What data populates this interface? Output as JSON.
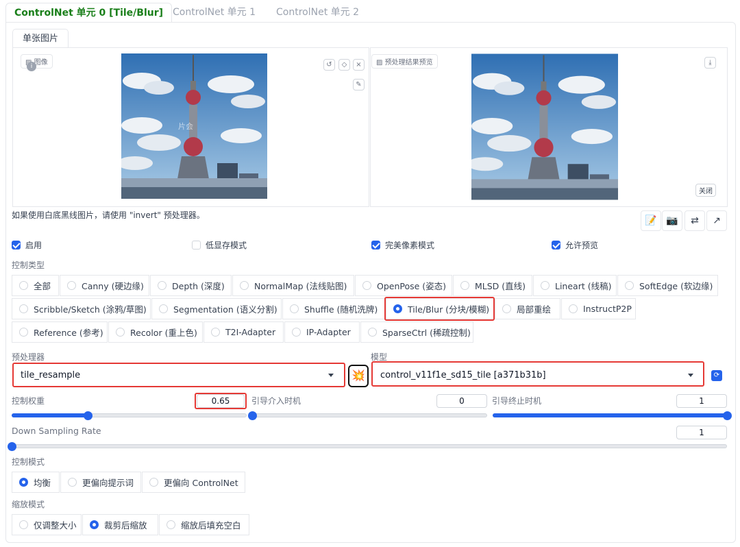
{
  "tabs": [
    "ControlNet 单元 0 [Tile/Blur]",
    "ControlNet 单元 1",
    "ControlNet 单元 2"
  ],
  "subtab": "单张图片",
  "image_label": "图像",
  "preview_label": "预处理结果预览",
  "close_label": "关闭",
  "watermark": "片会",
  "hint": "如果使用白底黑线图片，请使用 \"invert\" 预处理器。",
  "checkboxes": [
    {
      "label": "启用",
      "checked": true
    },
    {
      "label": "低显存模式",
      "checked": false
    },
    {
      "label": "完美像素模式",
      "checked": true
    },
    {
      "label": "允许预览",
      "checked": true
    }
  ],
  "control_type_label": "控制类型",
  "control_types": [
    "全部",
    "Canny (硬边缘)",
    "Depth (深度)",
    "NormalMap (法线贴图)",
    "OpenPose (姿态)",
    "MLSD (直线)",
    "Lineart (线稿)",
    "SoftEdge (软边缘)",
    "Scribble/Sketch (涂鸦/草图)",
    "Segmentation (语义分割)",
    "Shuffle (随机洗牌)",
    "Tile/Blur (分块/模糊)",
    "局部重绘",
    "InstructP2P",
    "Reference (参考)",
    "Recolor (重上色)",
    "T2I-Adapter",
    "IP-Adapter",
    "SparseCtrl (稀疏控制)"
  ],
  "selected_control_type": "Tile/Blur (分块/模糊)",
  "preprocessor_label": "预处理器",
  "preprocessor_value": "tile_resample",
  "model_label": "模型",
  "model_value": "control_v11f1e_sd15_tile [a371b31b]",
  "sliders": {
    "weight": {
      "label": "控制权重",
      "value": "0.65",
      "fraction": 0.325
    },
    "start": {
      "label": "引导介入时机",
      "value": "0",
      "fraction": 0
    },
    "end": {
      "label": "引导终止时机",
      "value": "1",
      "fraction": 1
    },
    "down": {
      "label": "Down Sampling Rate",
      "value": "1",
      "fraction": 0
    }
  },
  "control_mode_label": "控制模式",
  "control_modes": [
    "均衡",
    "更偏向提示词",
    "更偏向 ControlNet"
  ],
  "resize_mode_label": "缩放模式",
  "resize_modes": [
    "仅调整大小",
    "裁剪后缩放",
    "缩放后填充空白"
  ],
  "colors": {
    "accent": "#2563eb",
    "highlight": "#e53935",
    "active_tab": "#1a7f1a"
  }
}
